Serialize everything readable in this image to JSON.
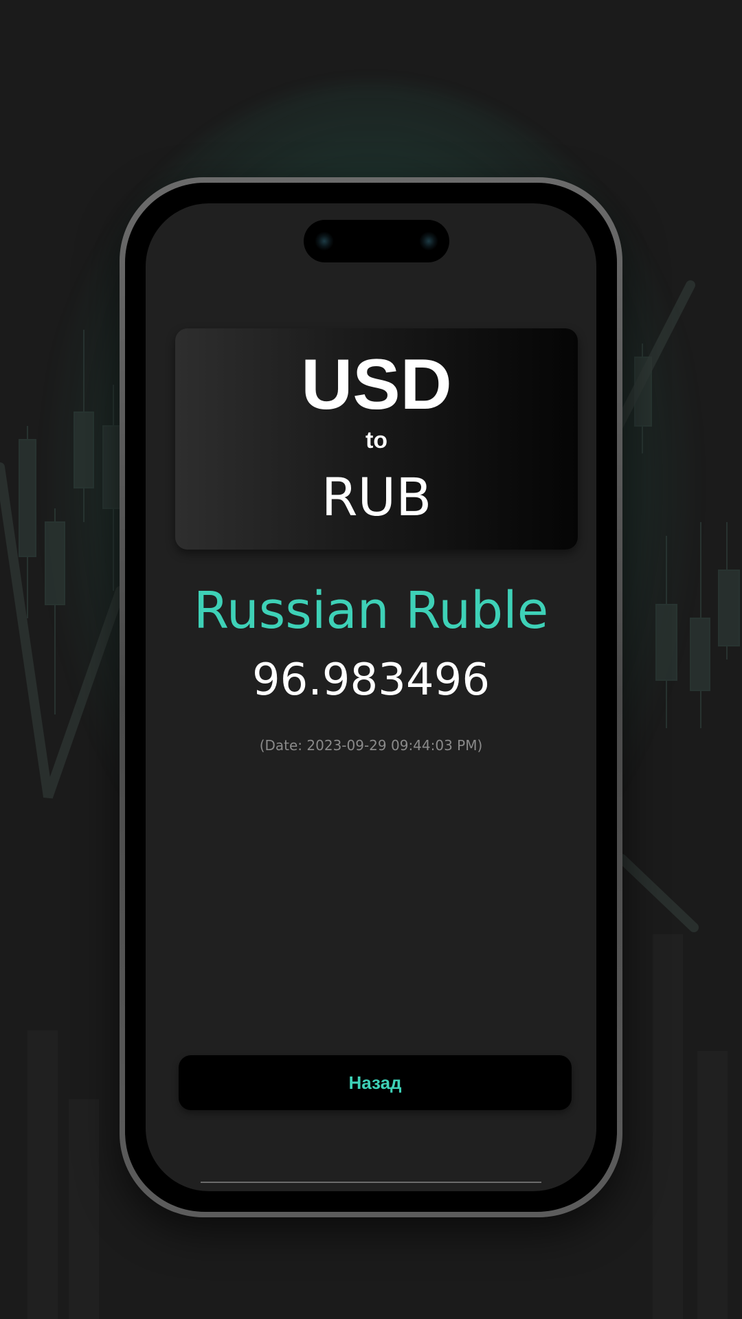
{
  "conversion": {
    "from_code": "USD",
    "connector": "to",
    "to_code": "RUB"
  },
  "result": {
    "currency_name": "Russian Ruble",
    "rate": "96.983496",
    "date_text": "(Date: 2023-09-29 09:44:03  PM)"
  },
  "actions": {
    "back_label": "Назад"
  },
  "colors": {
    "accent": "#3ed1b7",
    "background": "#1b1b1b",
    "screen": "#202020",
    "button": "#000000",
    "muted_text": "#8a8a8a"
  }
}
